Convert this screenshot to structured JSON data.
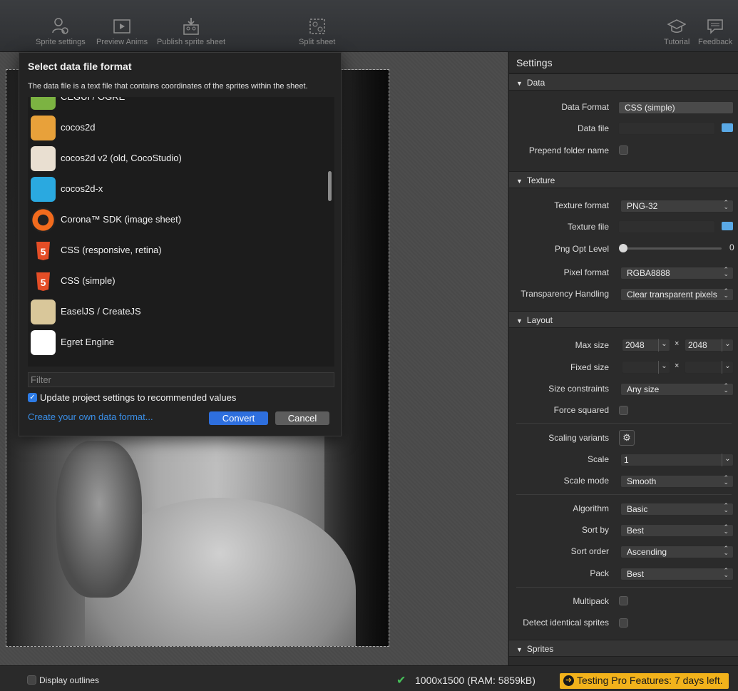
{
  "toolbar": {
    "sprite_settings": "Sprite settings",
    "preview_anims": "Preview Anims",
    "publish_sprite_sheet": "Publish sprite sheet",
    "split_sheet": "Split sheet",
    "tutorial": "Tutorial",
    "feedback": "Feedback"
  },
  "settings": {
    "title": "Settings",
    "data": {
      "header": "Data",
      "data_format_label": "Data Format",
      "data_format_value": "CSS (simple)",
      "data_file_label": "Data file",
      "prepend_folder_label": "Prepend folder name"
    },
    "texture": {
      "header": "Texture",
      "texture_format_label": "Texture format",
      "texture_format_value": "PNG-32",
      "texture_file_label": "Texture file",
      "png_opt_label": "Png Opt Level",
      "png_opt_value": "0",
      "pixel_format_label": "Pixel format",
      "pixel_format_value": "RGBA8888",
      "transparency_label": "Transparency Handling",
      "transparency_value": "Clear transparent pixels"
    },
    "layout": {
      "header": "Layout",
      "max_size_label": "Max size",
      "max_w": "2048",
      "max_h": "2048",
      "times": "×",
      "fixed_size_label": "Fixed size",
      "size_constraints_label": "Size constraints",
      "size_constraints_value": "Any size",
      "force_squared_label": "Force squared",
      "scaling_variants_label": "Scaling variants",
      "scale_label": "Scale",
      "scale_value": "1",
      "scale_mode_label": "Scale mode",
      "scale_mode_value": "Smooth",
      "algorithm_label": "Algorithm",
      "algorithm_value": "Basic",
      "sort_by_label": "Sort by",
      "sort_by_value": "Best",
      "sort_order_label": "Sort order",
      "sort_order_value": "Ascending",
      "pack_label": "Pack",
      "pack_value": "Best",
      "multipack_label": "Multipack",
      "detect_identical_label": "Detect identical sprites"
    },
    "sprites": {
      "header": "Sprites"
    }
  },
  "dialog": {
    "title": "Select data file format",
    "description": "The data file is a text file that contains coordinates of the sprites within the sheet.",
    "items": [
      {
        "label": "CEGUI / OGRE",
        "icon": "cegui-icon",
        "color": "#7cb342"
      },
      {
        "label": "cocos2d",
        "icon": "cocos2d-icon",
        "color": "#e8a13a"
      },
      {
        "label": "cocos2d v2 (old, CocoStudio)",
        "icon": "cocos2d-v2-icon",
        "color": "#e9dfd1"
      },
      {
        "label": "cocos2d-x",
        "icon": "cocos2d-x-icon",
        "color": "#2aa9e0"
      },
      {
        "label": "Corona™ SDK (image sheet)",
        "icon": "corona-icon",
        "color": "#f26b1d"
      },
      {
        "label": "CSS (responsive, retina)",
        "icon": "html5-icon",
        "color": "#e44d26"
      },
      {
        "label": "CSS (simple)",
        "icon": "html5-icon",
        "color": "#e44d26"
      },
      {
        "label": "EaselJS / CreateJS",
        "icon": "easeljs-icon",
        "color": "#d9c79a"
      },
      {
        "label": "Egret Engine",
        "icon": "egret-icon",
        "color": "#ffffff"
      }
    ],
    "filter_placeholder": "Filter",
    "update_settings_label": "Update project settings to recommended values",
    "create_link": "Create your own data format...",
    "convert_label": "Convert",
    "cancel_label": "Cancel"
  },
  "statusbar": {
    "display_outlines_label": "Display outlines",
    "status_text": "1000x1500 (RAM: 5859kB)",
    "pro_badge": "Testing Pro Features: 7 days left."
  }
}
